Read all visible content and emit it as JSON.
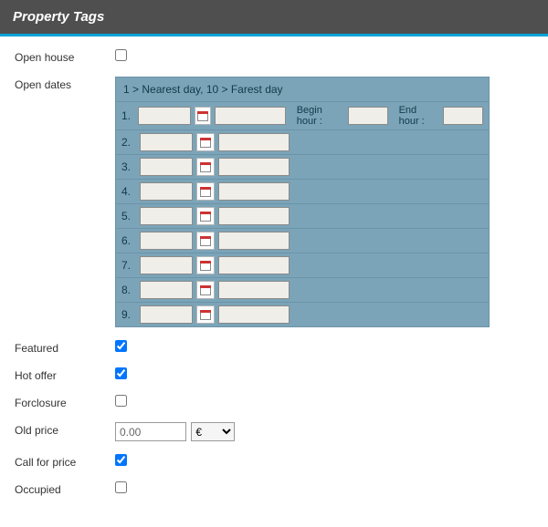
{
  "header": {
    "title": "Property Tags"
  },
  "fields": {
    "open_house": {
      "label": "Open house",
      "checked": false
    },
    "open_dates": {
      "label": "Open dates",
      "hint": "1 > Nearest day, 10 > Farest day",
      "begin_hour_label": "Begin hour :",
      "end_hour_label": "End hour :",
      "rows": [
        {
          "num": "1.",
          "date": "",
          "extra": "",
          "begin": "",
          "end": ""
        },
        {
          "num": "2.",
          "date": "",
          "extra": ""
        },
        {
          "num": "3.",
          "date": "",
          "extra": ""
        },
        {
          "num": "4.",
          "date": "",
          "extra": ""
        },
        {
          "num": "5.",
          "date": "",
          "extra": ""
        },
        {
          "num": "6.",
          "date": "",
          "extra": ""
        },
        {
          "num": "7.",
          "date": "",
          "extra": ""
        },
        {
          "num": "8.",
          "date": "",
          "extra": ""
        },
        {
          "num": "9.",
          "date": "",
          "extra": ""
        }
      ]
    },
    "featured": {
      "label": "Featured",
      "checked": true
    },
    "hot_offer": {
      "label": "Hot offer",
      "checked": true
    },
    "forclosure": {
      "label": "Forclosure",
      "checked": false
    },
    "old_price": {
      "label": "Old price",
      "value": "0.00",
      "currency": "€"
    },
    "call_for_price": {
      "label": "Call for price",
      "checked": true
    },
    "occupied": {
      "label": "Occupied",
      "checked": false
    }
  }
}
